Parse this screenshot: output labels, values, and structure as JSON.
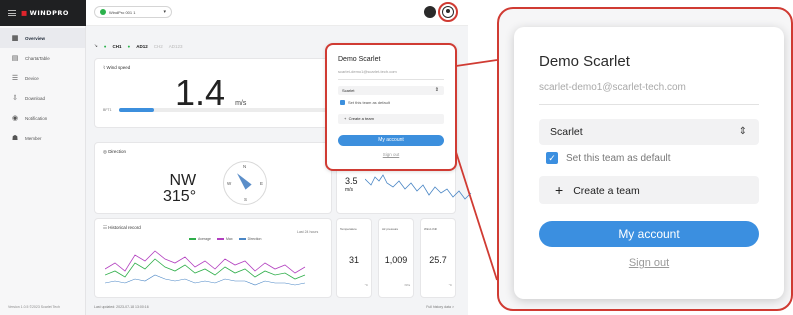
{
  "app": {
    "brand": "WINDPRO",
    "site_select": "WindPro 001 1",
    "version": "Version 1.0.5 ©2023 Scarlet Tech"
  },
  "sidebar": {
    "items": [
      {
        "label": "Overview",
        "icon": "grid-icon"
      },
      {
        "label": "Chart&Table",
        "icon": "chart-icon"
      },
      {
        "label": "Device",
        "icon": "device-icon"
      },
      {
        "label": "Download",
        "icon": "download-icon"
      },
      {
        "label": "Notification",
        "icon": "bell-icon"
      },
      {
        "label": "Member",
        "icon": "members-icon"
      }
    ]
  },
  "channels": {
    "ch1": "CH1",
    "ad12": "AD12",
    "ch2": "CH2",
    "ad123": "AD123"
  },
  "wind": {
    "title": "Wind speed",
    "value": "1.4",
    "unit": "m/s",
    "scale_left": "BFT1",
    "scale_right": "150",
    "level": 0.12
  },
  "direction": {
    "title": "Direction",
    "cardinal": "NW",
    "degrees": "315°",
    "n": "N",
    "e": "E",
    "s": "S",
    "w": "W"
  },
  "mini_chart": {
    "value": "3.5",
    "unit": "m/s"
  },
  "history": {
    "title": "Historical record",
    "range": "Last 24 hours",
    "legend": [
      "Average",
      "Max",
      "Direction"
    ]
  },
  "stats": [
    {
      "label": "Temperature",
      "value": "31",
      "unit": "°C"
    },
    {
      "label": "Air pressure",
      "value": "1,009",
      "unit": "hPa"
    },
    {
      "label": "Wind chill",
      "value": "25.7",
      "unit": "°C"
    }
  ],
  "footer": {
    "updated": "Last updated: 2023-07-18 13:00:16",
    "history_link": "Full history data >"
  },
  "account_menu": {
    "name": "Demo Scarlet",
    "email": "scarlet-demo1@scarlet-tech.com",
    "team": "Scarlet",
    "default_label": "Set this team as default",
    "default_checked": true,
    "create_team": "Create a team",
    "my_account": "My account",
    "sign_out": "Sign out"
  },
  "colors": {
    "accent": "#3b8fe0",
    "highlight": "#d03b33",
    "online": "#2bb24c"
  }
}
